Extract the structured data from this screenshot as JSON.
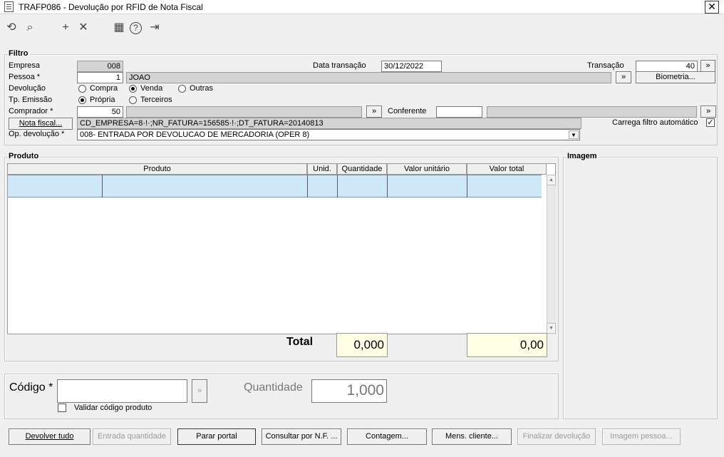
{
  "window": {
    "title": "TRAFP086 - Devolução por RFID de Nota Fiscal",
    "close_glyph": "✕"
  },
  "toolbar": {
    "refresh": "⟲",
    "search": "⌕",
    "add": "+",
    "delete": "✕",
    "calendar": "▦",
    "help": "?",
    "exit": "⇥"
  },
  "filtro": {
    "title": "Filtro",
    "empresa_label": "Empresa",
    "empresa_value": "008",
    "data_transacao_label": "Data transação",
    "data_transacao_value": "30/12/2022",
    "transacao_label": "Transação",
    "transacao_value": "40",
    "pessoa_label": "Pessoa *",
    "pessoa_value": "1",
    "pessoa_name": "JOAO",
    "biometria_label": "Biometria...",
    "devolucao_label": "Devolução",
    "devolucao_options": [
      "Compra",
      "Venda",
      "Outras"
    ],
    "devolucao_selected": "Venda",
    "tp_emissao_label": "Tp. Emissão",
    "tp_emissao_options": [
      "Própria",
      "Terceiros"
    ],
    "tp_emissao_selected": "Própria",
    "comprador_label": "Comprador *",
    "comprador_value": "50",
    "conferente_label": "Conferente",
    "conferente_value": "",
    "nota_fiscal_label": "Nota fiscal...",
    "nota_fiscal_value": "CD_EMPRESA=8·!·;NR_FATURA=156585·!·;DT_FATURA=20140813",
    "carrega_filtro_label": "Carrega filtro automático",
    "carrega_filtro_checked": true,
    "op_devolucao_label": "Op. devolução *",
    "op_devolucao_value": "008- ENTRADA POR DEVOLUCAO DE MERCADORIA (OPER 8)",
    "lookup_glyph": "»"
  },
  "produto": {
    "title": "Produto",
    "columns": [
      "Produto",
      "Unid.",
      "Quantidade",
      "Valor unitário",
      "Valor total"
    ],
    "total_label": "Total",
    "total_quantidade": "0,000",
    "total_valor": "0,00"
  },
  "imagem": {
    "title": "Imagem"
  },
  "codigo": {
    "label": "Código *",
    "value": "",
    "quantidade_label": "Quantidade",
    "quantidade_value": "1,000",
    "validar_label": "Validar código produto",
    "validar_checked": false
  },
  "buttons": {
    "devolver_tudo": "Devolver tudo",
    "entrada_quantidade": "Entrada quantidade",
    "parar_portal": "Parar portal",
    "consultar_nf": "Consultar por N.F. ...",
    "contagem": "Contagem...",
    "mens_cliente": "Mens. cliente...",
    "finalizar_devolucao": "Finalizar devolução",
    "imagem_pessoa": "Imagem pessoa..."
  }
}
